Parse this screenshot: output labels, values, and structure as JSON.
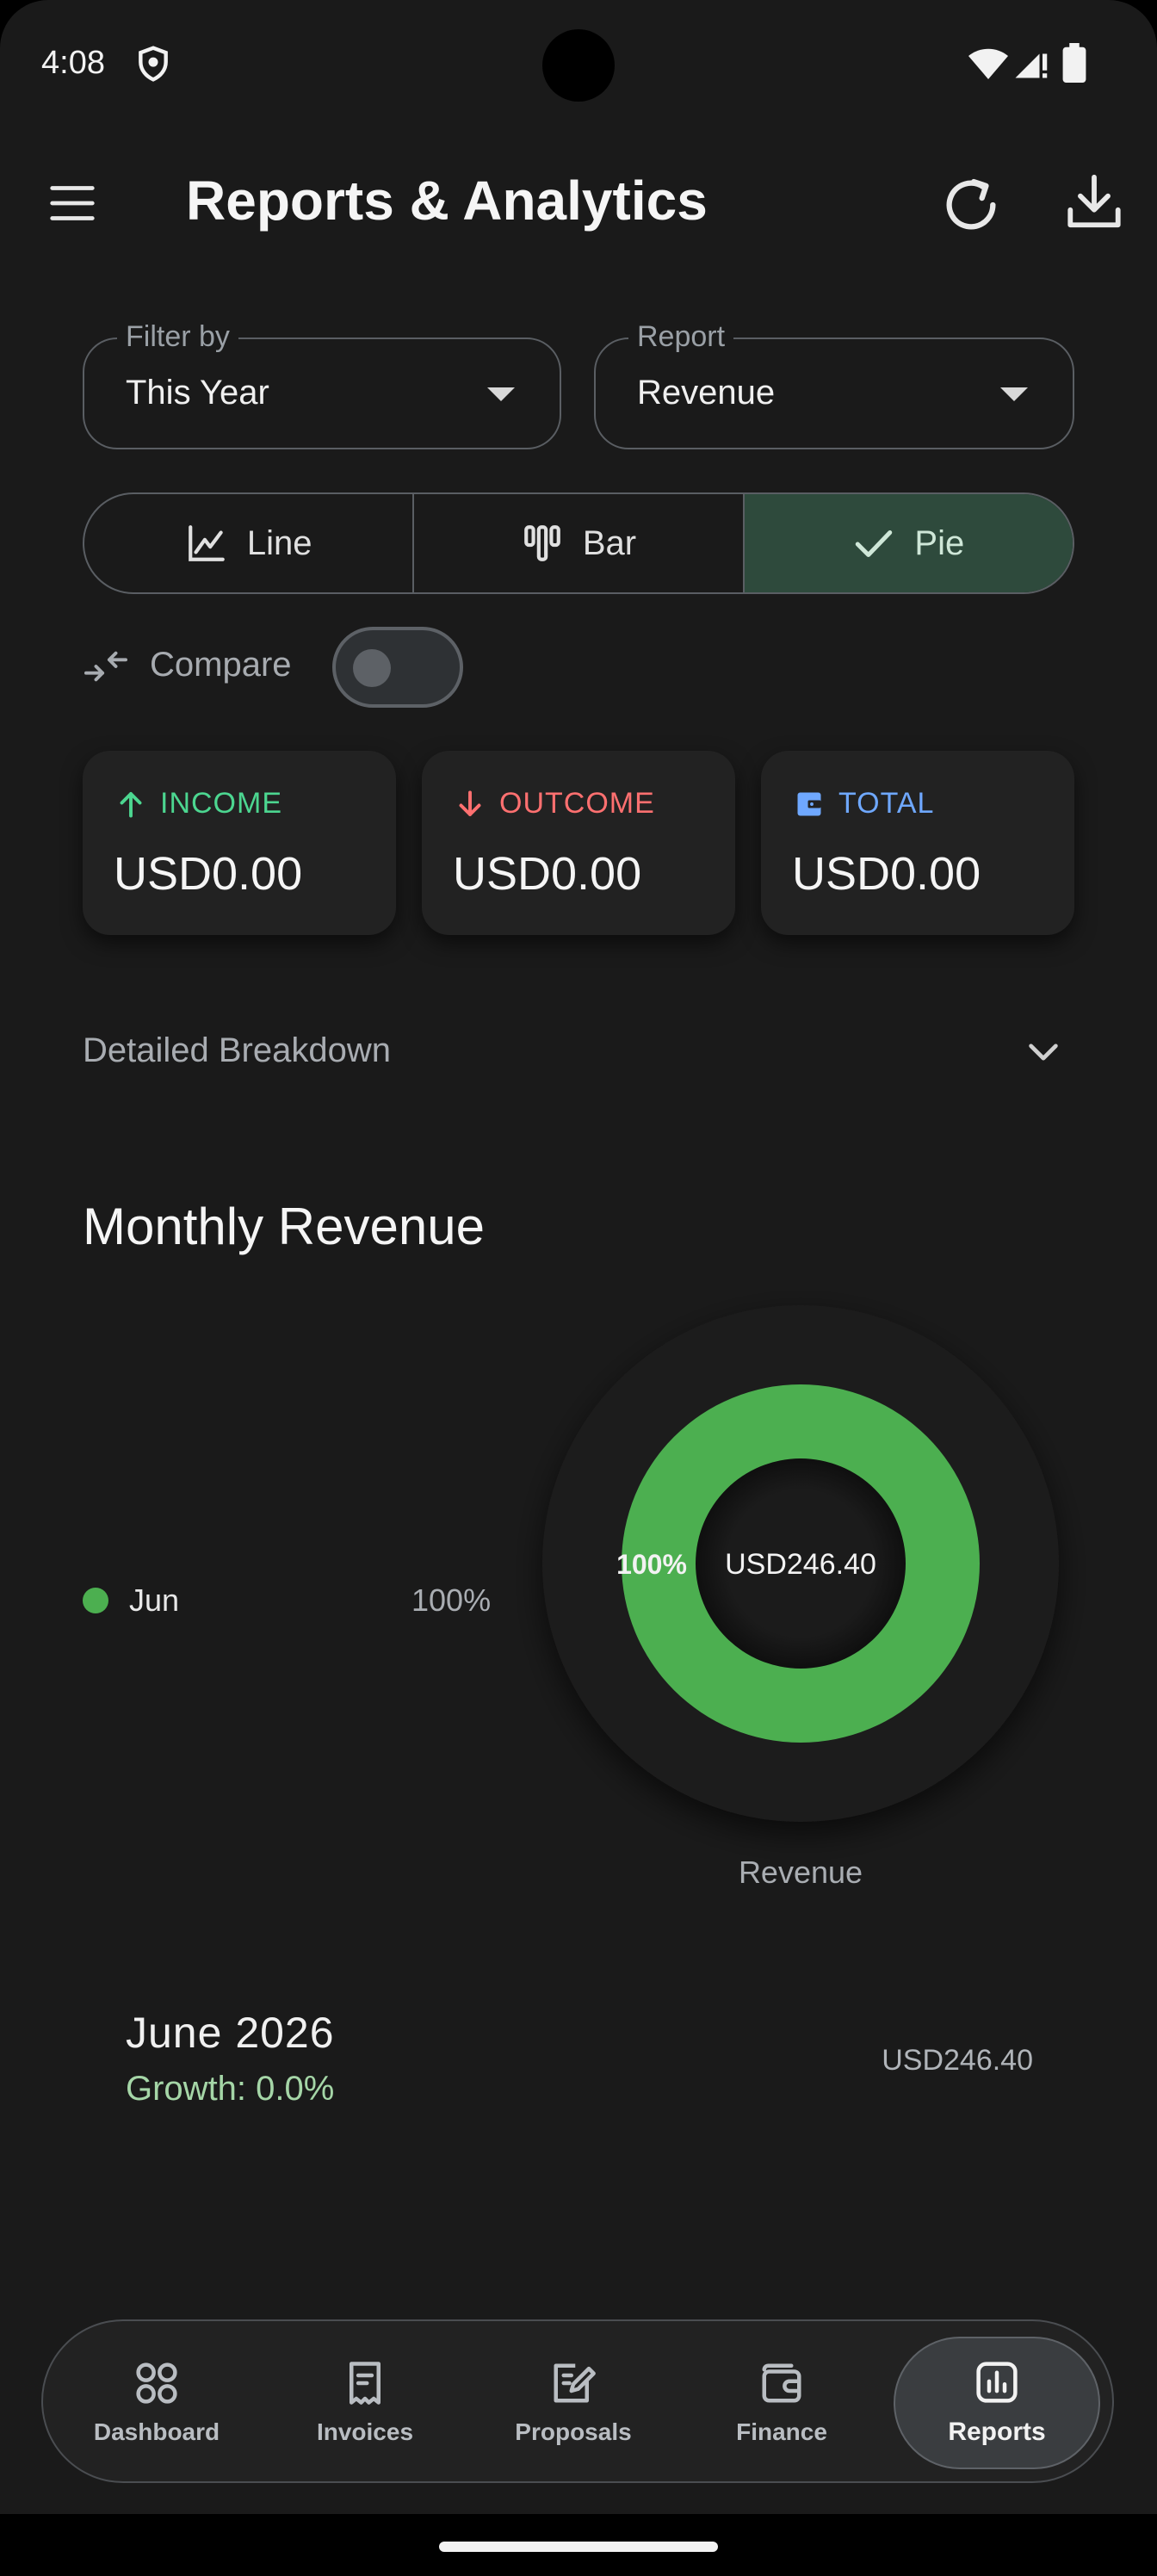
{
  "status_bar": {
    "time": "4:08"
  },
  "app_bar": {
    "title": "Reports & Analytics",
    "icons": [
      "menu-icon",
      "refresh-icon",
      "download-icon"
    ]
  },
  "filters": {
    "filter_by": {
      "label": "Filter by",
      "value": "This Year"
    },
    "report": {
      "label": "Report",
      "value": "Revenue"
    }
  },
  "chart_type_selector": {
    "options": [
      {
        "label": "Line",
        "icon": "line-chart-icon",
        "selected": false
      },
      {
        "label": "Bar",
        "icon": "bar-chart-icon",
        "selected": false
      },
      {
        "label": "Pie",
        "icon": "check-icon",
        "selected": true
      }
    ]
  },
  "compare": {
    "label": "Compare",
    "enabled": false
  },
  "summary_cards": [
    {
      "label": "INCOME",
      "value": "USD0.00",
      "color": "#4cd690",
      "icon": "arrow-up-icon"
    },
    {
      "label": "OUTCOME",
      "value": "USD0.00",
      "color": "#ff7070",
      "icon": "arrow-down-icon"
    },
    {
      "label": "TOTAL",
      "value": "USD0.00",
      "color": "#6fa8ff",
      "icon": "wallet-icon"
    }
  ],
  "breakdown": {
    "label": "Detailed Breakdown"
  },
  "section": {
    "title": "Monthly Revenue"
  },
  "chart_data": {
    "type": "pie",
    "title": "Monthly Revenue",
    "categories": [
      "Jun"
    ],
    "values": [
      246.4
    ],
    "percent_labels": [
      "100%"
    ],
    "colors": [
      "#4caf50"
    ],
    "center_label": "USD246.40",
    "caption": "Revenue",
    "legend": [
      {
        "label": "Jun",
        "percent": "100%"
      }
    ],
    "legend_position": "left"
  },
  "month_row": {
    "title": "June 2026",
    "growth": "Growth: 0.0%",
    "amount": "USD246.40"
  },
  "bottom_nav": {
    "items": [
      {
        "label": "Dashboard",
        "icon": "dashboard-icon",
        "active": false
      },
      {
        "label": "Invoices",
        "icon": "invoice-icon",
        "active": false
      },
      {
        "label": "Proposals",
        "icon": "proposal-icon",
        "active": false
      },
      {
        "label": "Finance",
        "icon": "wallet-icon",
        "active": false
      },
      {
        "label": "Reports",
        "icon": "reports-icon",
        "active": true
      }
    ]
  }
}
